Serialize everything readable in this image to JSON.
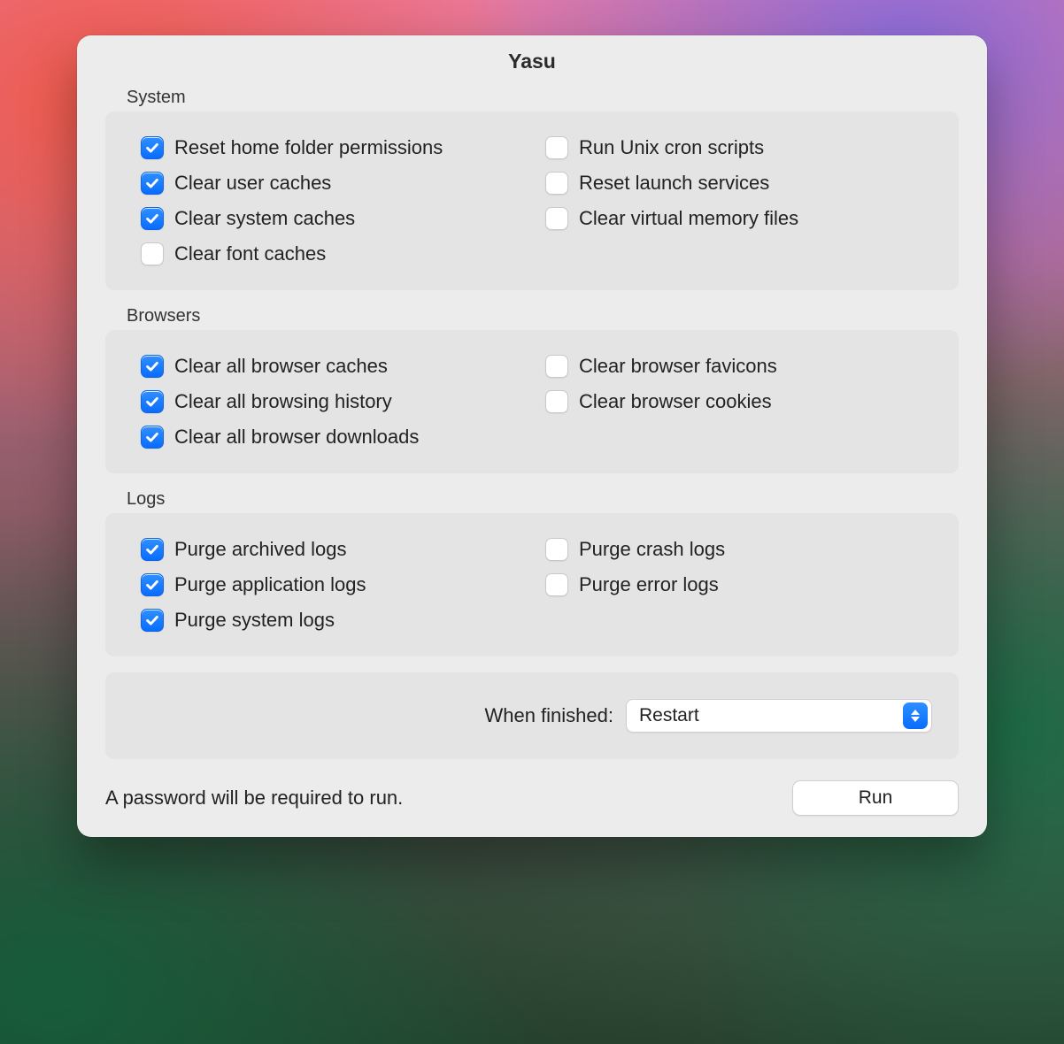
{
  "window": {
    "title": "Yasu"
  },
  "sections": {
    "system": {
      "label": "System",
      "left": [
        {
          "key": "reset_home_perms",
          "label": "Reset home folder permissions",
          "checked": true
        },
        {
          "key": "clear_user_caches",
          "label": "Clear user caches",
          "checked": true
        },
        {
          "key": "clear_system_caches",
          "label": "Clear system caches",
          "checked": true
        },
        {
          "key": "clear_font_caches",
          "label": "Clear font caches",
          "checked": false
        }
      ],
      "right": [
        {
          "key": "run_unix_cron",
          "label": "Run Unix cron scripts",
          "checked": false
        },
        {
          "key": "reset_launch_services",
          "label": "Reset launch services",
          "checked": false
        },
        {
          "key": "clear_vm_files",
          "label": "Clear virtual memory files",
          "checked": false
        }
      ]
    },
    "browsers": {
      "label": "Browsers",
      "left": [
        {
          "key": "clear_browser_caches",
          "label": "Clear all browser caches",
          "checked": true
        },
        {
          "key": "clear_browsing_history",
          "label": "Clear all browsing history",
          "checked": true
        },
        {
          "key": "clear_browser_downloads",
          "label": "Clear all browser downloads",
          "checked": true
        }
      ],
      "right": [
        {
          "key": "clear_browser_favicons",
          "label": "Clear browser favicons",
          "checked": false
        },
        {
          "key": "clear_browser_cookies",
          "label": "Clear browser cookies",
          "checked": false
        }
      ]
    },
    "logs": {
      "label": "Logs",
      "left": [
        {
          "key": "purge_archived_logs",
          "label": "Purge archived logs",
          "checked": true
        },
        {
          "key": "purge_application_logs",
          "label": "Purge application logs",
          "checked": true
        },
        {
          "key": "purge_system_logs",
          "label": "Purge system logs",
          "checked": true
        }
      ],
      "right": [
        {
          "key": "purge_crash_logs",
          "label": "Purge crash logs",
          "checked": false
        },
        {
          "key": "purge_error_logs",
          "label": "Purge error logs",
          "checked": false
        }
      ]
    }
  },
  "finish": {
    "label": "When finished:",
    "selected": "Restart"
  },
  "footer": {
    "note": "A password will be required to run.",
    "run_label": "Run"
  }
}
